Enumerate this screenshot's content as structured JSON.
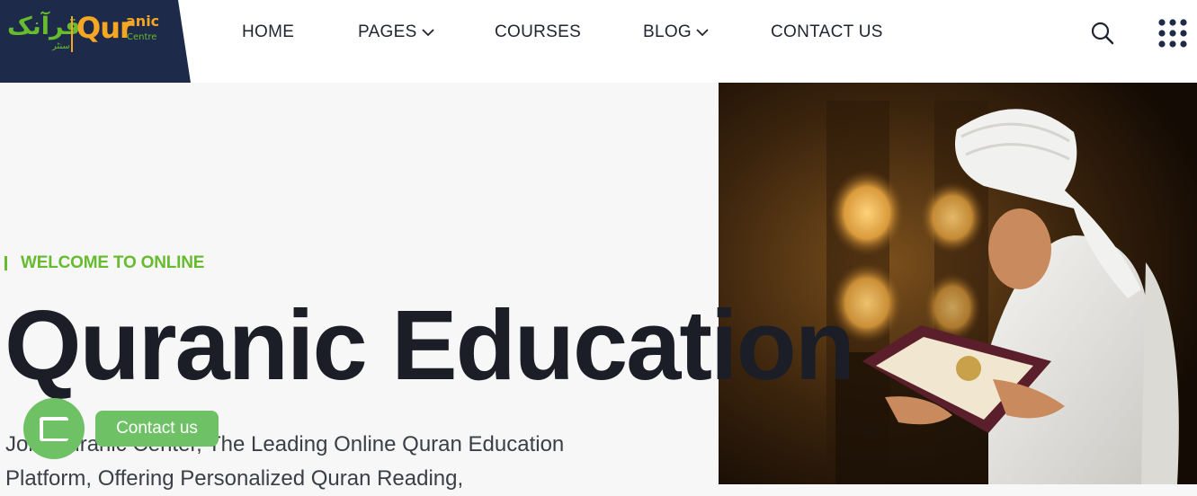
{
  "logo": {
    "arabic": "قرآنک",
    "arabic_sub": "سنٹر",
    "qur": "Qur",
    "anic": "anic",
    "centre": "Centre"
  },
  "nav": {
    "home": "HOME",
    "pages": "PAGES",
    "courses": "COURSES",
    "blog": "BLOG",
    "contact": "CONTACT US"
  },
  "icons": {
    "search": "search-icon",
    "grid_menu": "grid-menu-icon",
    "chevron": "chevron-down-icon",
    "chat": "chat-icon"
  },
  "hero": {
    "eyebrow": "WELCOME TO ONLINE",
    "title": "Quranic Education",
    "description": "Join Quranic Center, The Leading Online Quran Education Platform, Offering Personalized Quran Reading,"
  },
  "contact_widget": {
    "label": "Contact us"
  },
  "colors": {
    "brand_navy": "#1e2a4a",
    "accent_green": "#66bb2e",
    "accent_orange": "#f5a623",
    "widget_green": "#6fc166",
    "headline": "#1b1e26"
  }
}
